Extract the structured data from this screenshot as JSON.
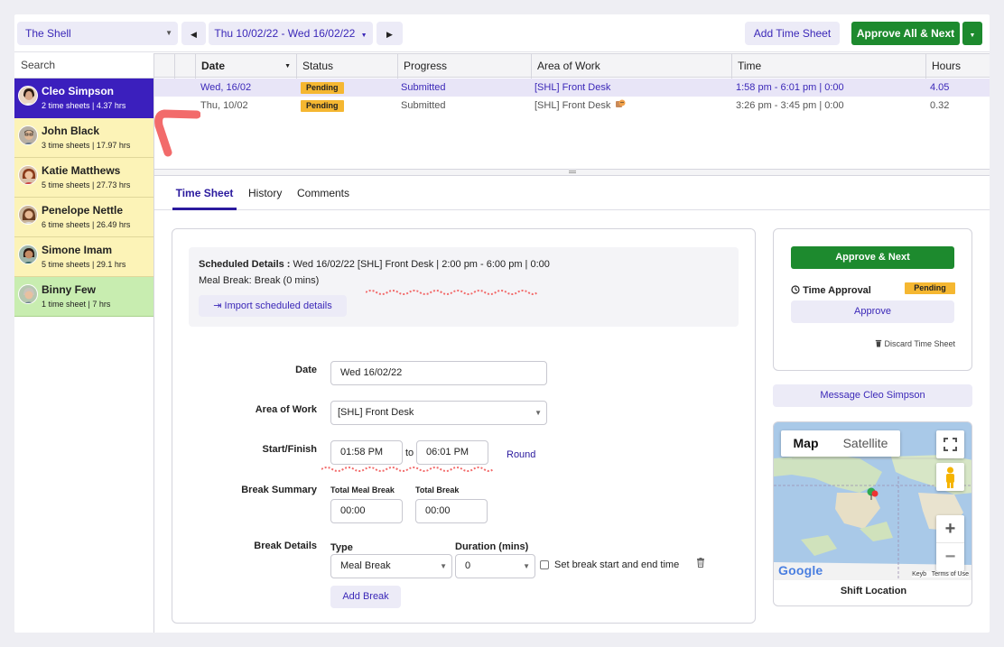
{
  "topbar": {
    "location": "The Shell",
    "date_range": "Thu 10/02/22 - Wed 16/02/22",
    "add_timesheet": "Add Time Sheet",
    "approve_all": "Approve All & Next"
  },
  "sidebar": {
    "search_placeholder": "Search",
    "employees": [
      {
        "name": "Cleo Simpson",
        "summary": "2 time sheets | 4.37 hrs"
      },
      {
        "name": "John Black",
        "summary": "3 time sheets | 17.97 hrs"
      },
      {
        "name": "Katie Matthews",
        "summary": "5 time sheets | 27.73 hrs"
      },
      {
        "name": "Penelope Nettle",
        "summary": "6 time sheets | 26.49 hrs"
      },
      {
        "name": "Simone Imam",
        "summary": "5 time sheets | 29.1 hrs"
      },
      {
        "name": "Binny Few",
        "summary": "1 time sheet | 7 hrs"
      }
    ]
  },
  "grid": {
    "headers": {
      "date": "Date",
      "status": "Status",
      "progress": "Progress",
      "area": "Area of Work",
      "time": "Time",
      "hours": "Hours"
    },
    "rows": [
      {
        "date": "Wed, 16/02",
        "status": "Pending",
        "progress": "Submitted",
        "area": "[SHL] Front Desk",
        "time": "1:58 pm - 6:01 pm | 0:00",
        "hours": "4.05"
      },
      {
        "date": "Thu, 10/02",
        "status": "Pending",
        "progress": "Submitted",
        "area": "[SHL] Front Desk",
        "time": "3:26 pm - 3:45 pm | 0:00",
        "hours": "0.32"
      }
    ]
  },
  "tabs": [
    "Time Sheet",
    "History",
    "Comments"
  ],
  "scheduled": {
    "label": "Scheduled Details :",
    "details": "Wed 16/02/22 [SHL] Front Desk | 2:00 pm - 6:00 pm | 0:00",
    "meal_break": "Meal Break: Break (0 mins)",
    "import_btn": "Import scheduled details"
  },
  "form": {
    "date_label": "Date",
    "date_value": "Wed 16/02/22",
    "area_label": "Area of Work",
    "area_value": "[SHL] Front Desk",
    "start_finish_label": "Start/Finish",
    "start_value": "01:58 PM",
    "to": "to",
    "finish_value": "06:01 PM",
    "round": "Round",
    "break_summary_label": "Break Summary",
    "total_meal_label": "Total Meal Break",
    "total_meal_value": "00:00",
    "total_break_label": "Total Break",
    "total_break_value": "00:00",
    "break_details_label": "Break Details",
    "type_label": "Type",
    "type_value": "Meal Break",
    "duration_label": "Duration (mins)",
    "duration_value": "0",
    "set_start_end": "Set break start and end time",
    "add_break": "Add Break"
  },
  "approval": {
    "approve_next": "Approve & Next",
    "time_approval": "Time Approval",
    "status": "Pending",
    "approve": "Approve",
    "discard": "Discard Time Sheet",
    "message": "Message Cleo Simpson"
  },
  "map": {
    "map_tab": "Map",
    "satellite_tab": "Satellite",
    "caption": "Shift Location",
    "logo": "Google",
    "attribution": "Keyb   Terms of Use",
    "zoom_in": "+",
    "zoom_out": "−"
  },
  "colors": {
    "accent": "#3b1fbd",
    "green": "#1d8a2e",
    "pending": "#f5b731",
    "lavender": "#ecebf7"
  }
}
